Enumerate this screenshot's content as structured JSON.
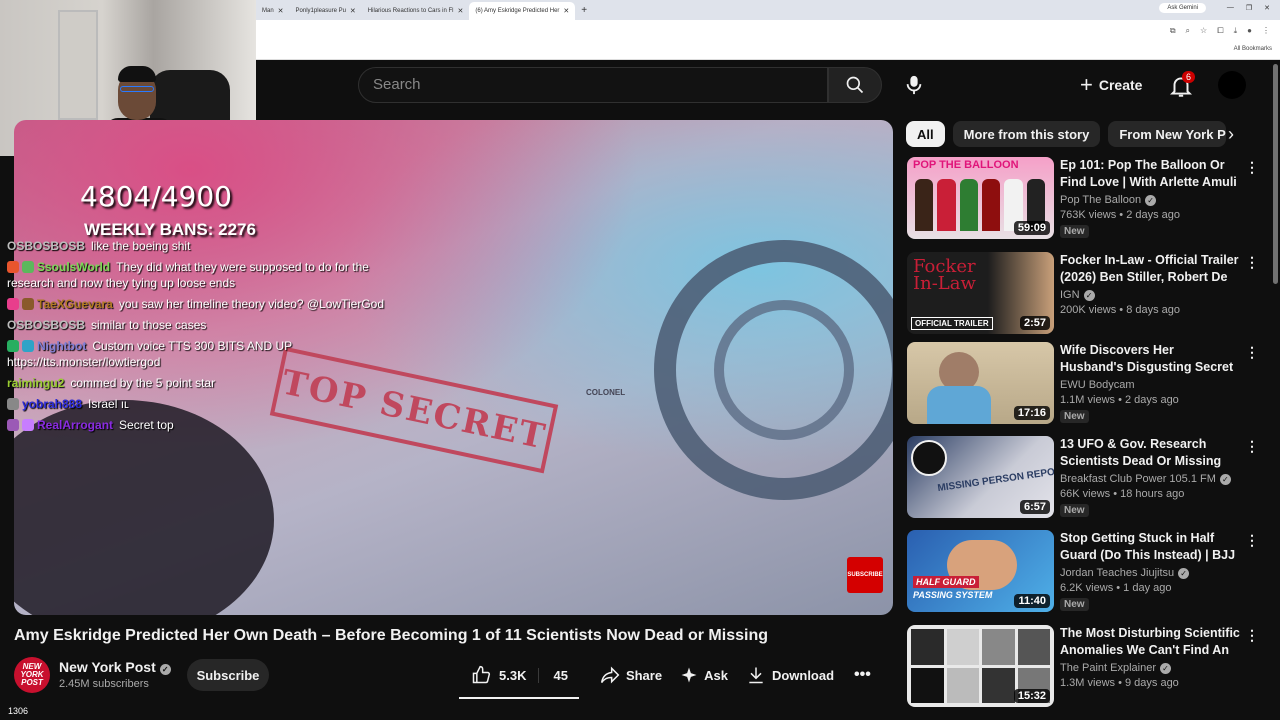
{
  "browser": {
    "tabs": [
      {
        "label": "Man",
        "active": false
      },
      {
        "label": "Ponly1pleasure Pu",
        "active": false
      },
      {
        "label": "Hilarious Reactions to Cars in Fl",
        "active": false
      },
      {
        "label": "(6) Amy Eskridge Predicted Her",
        "active": true
      }
    ],
    "gemini_label": "Ask Gemini",
    "bookmarks_label": "All Bookmarks"
  },
  "header": {
    "search_placeholder": "Search",
    "create_label": "Create",
    "notification_count": "6"
  },
  "stream": {
    "counter": "4804/4900",
    "weekly_bans": "WEEKLY BANS: 2276",
    "viewer_count": "1306",
    "chat": [
      {
        "user": "OSBOSBOSB",
        "text": "like the boeing shit",
        "color": "#bdbdbd"
      },
      {
        "user": "SsoulsWorld",
        "text": "They did what they were supposed to do for the research and now they tying up loose ends",
        "color": "#7cd957"
      },
      {
        "user": "TaeXGuevara",
        "text": "you saw her timeline theory video? @LowTierGod",
        "color": "#b07a22"
      },
      {
        "user": "OSBOSBOSB",
        "text": "similar to those cases",
        "color": "#bdbdbd"
      },
      {
        "user": "Nightbot",
        "text": "Custom voice TTS 300 BITS AND UP https://tts.monster/lowtiergod",
        "color": "#7f7fd5"
      },
      {
        "user": "raimingu2",
        "text": "commed by the 5 point star",
        "color": "#9acd32"
      },
      {
        "user": "yobrah888",
        "text": "Israel ıʟ",
        "color": "#2b2bd8"
      },
      {
        "user": "RealArrogant",
        "text": "Secret top",
        "color": "#8a2be2"
      }
    ]
  },
  "video": {
    "stamp_text": "TOP SECRET",
    "colonel_text": "COLONEL",
    "corner_label": "SUBSCRIBE",
    "title": "Amy Eskridge Predicted Her Own Death – Before Becoming 1 of 11 Scientists Now Dead or Missing",
    "channel": "New York Post",
    "channel_logo": "NEW YORK POST",
    "subscribers": "2.45M subscribers",
    "subscribe_label": "Subscribe",
    "likes": "5.3K",
    "dislikes": "45",
    "share_label": "Share",
    "ask_label": "Ask",
    "download_label": "Download"
  },
  "sidebar": {
    "chips": [
      "All",
      "More from this story",
      "From New York Post"
    ],
    "recommendations": [
      {
        "title": "Ep 101: Pop The Balloon Or Find Love | With Arlette Amuli",
        "channel": "Pop The Balloon",
        "verified": true,
        "meta": "763K views • 2 days ago",
        "badge": "New",
        "duration": "59:09",
        "thumb_label": "POP THE BALLOON",
        "colors": [
          "#f5a0c8",
          "#e8e0e4"
        ]
      },
      {
        "title": "Focker In-Law - Official Trailer (2026) Ben Stiller, Robert De ...",
        "channel": "IGN",
        "verified": true,
        "meta": "200K views • 8 days ago",
        "badge": "",
        "duration": "2:57",
        "thumb_label": "OFFICIAL TRAILER",
        "colors": [
          "#1d1d1d",
          "#c9a07a"
        ]
      },
      {
        "title": "Wife Discovers Her Husband's Disgusting Secret",
        "channel": "EWU Bodycam",
        "verified": false,
        "meta": "1.1M views • 2 days ago",
        "badge": "New",
        "duration": "17:16",
        "thumb_label": "",
        "colors": [
          "#d7c7a8",
          "#5fa7d6"
        ]
      },
      {
        "title": "13 UFO & Gov. Research Scientists Dead Or Missing",
        "channel": "Breakfast Club Power 105.1 FM",
        "verified": true,
        "meta": "66K views • 18 hours ago",
        "badge": "New",
        "duration": "6:57",
        "thumb_label": "MISSING PERSON REPORT",
        "colors": [
          "#2b3d63",
          "#c9cbd6"
        ]
      },
      {
        "title": "Stop Getting Stuck in Half Guard (Do This Instead) | BJJ ...",
        "channel": "Jordan Teaches Jiujitsu",
        "verified": true,
        "meta": "6.2K views • 1 day ago",
        "badge": "New",
        "duration": "11:40",
        "thumb_label": "PASSING SYSTEM",
        "colors": [
          "#2a5fb0",
          "#4fb0e8"
        ]
      },
      {
        "title": "The Most Disturbing Scientific Anomalies We Can't Find An ...",
        "channel": "The Paint Explainer",
        "verified": true,
        "meta": "1.3M views • 9 days ago",
        "badge": "",
        "duration": "15:32",
        "thumb_label": "",
        "colors": [
          "#e9e9e9",
          "#3a3a3a"
        ]
      }
    ]
  }
}
